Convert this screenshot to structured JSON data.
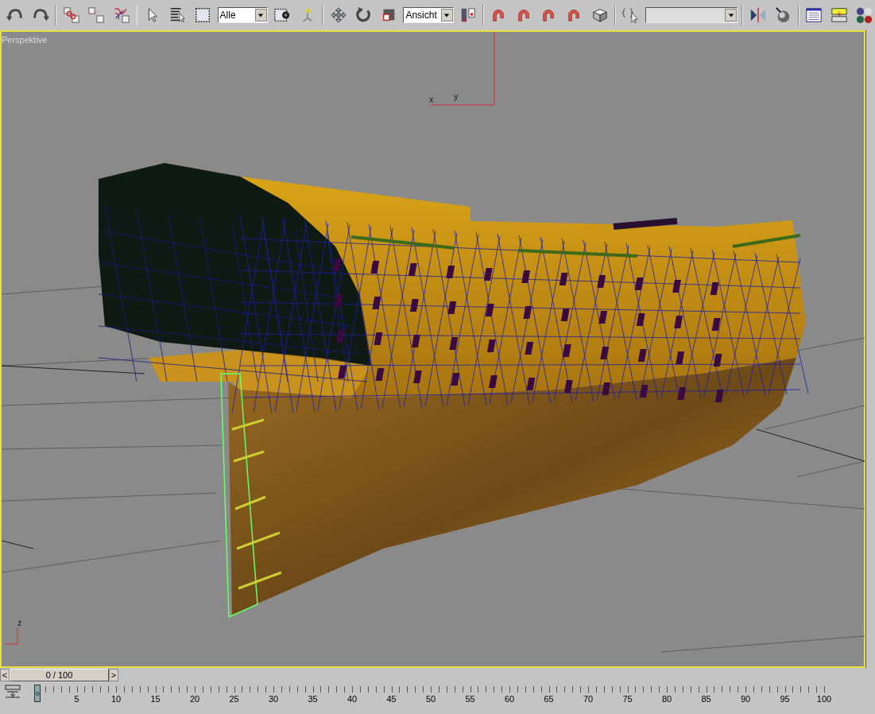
{
  "toolbar": {
    "selection_filter": "Alle",
    "reference_coordinate": "Ansicht"
  },
  "viewport": {
    "label": "Perspektive",
    "axis_top": [
      "x",
      "y"
    ],
    "axis_bottom": "z"
  },
  "time_slider": {
    "prev": "<",
    "frame": "0 / 100",
    "next": ">",
    "level": 0
  },
  "track_bar": {
    "thumb": "0",
    "ticks": [
      "5",
      "10",
      "15",
      "20",
      "25",
      "30",
      "35",
      "40",
      "45",
      "50",
      "55",
      "60",
      "65",
      "70",
      "75",
      "80",
      "85",
      "90",
      "95",
      "100"
    ]
  }
}
